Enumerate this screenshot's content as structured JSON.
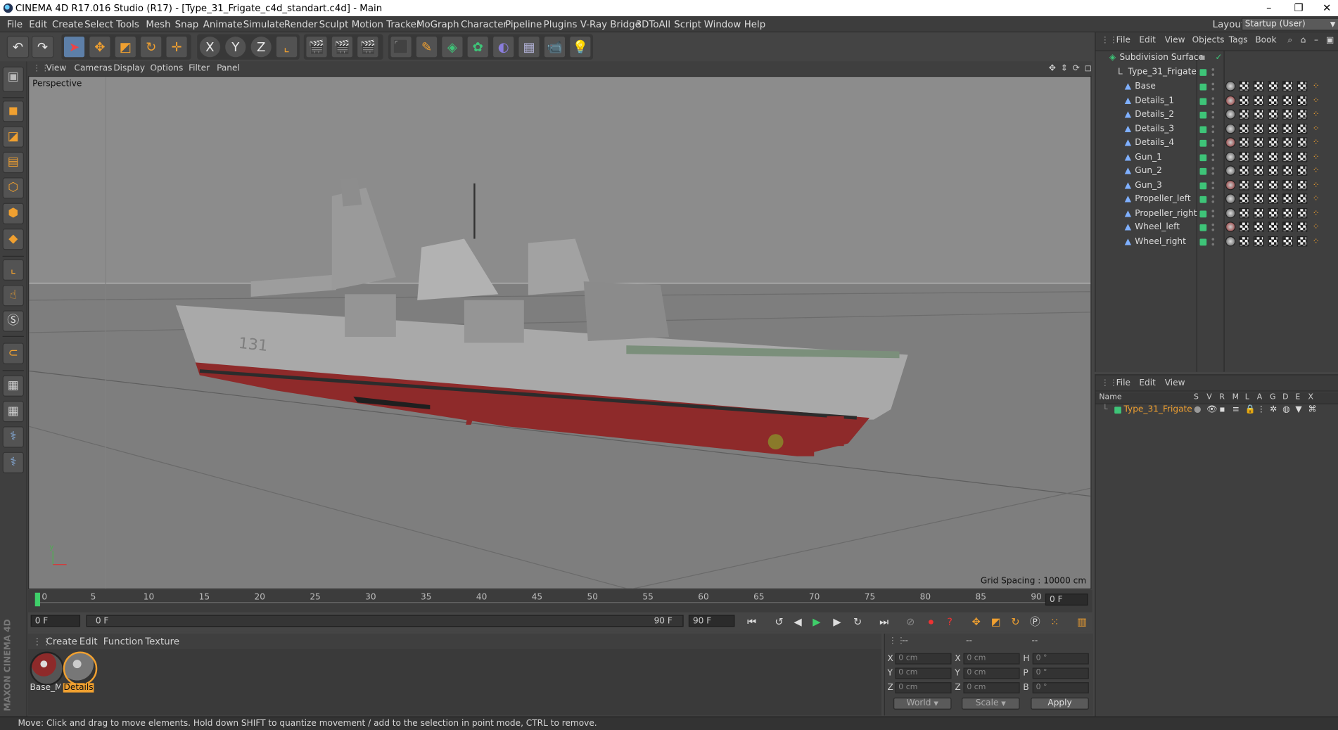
{
  "window": {
    "title": "CINEMA 4D R17.016 Studio (R17) - [Type_31_Frigate_c4d_standart.c4d] - Main",
    "min": "–",
    "max": "❐",
    "close": "✕"
  },
  "menu": [
    "File",
    "Edit",
    "Create",
    "Select",
    "Tools",
    "Mesh",
    "Snap",
    "Animate",
    "Simulate",
    "Render",
    "Sculpt",
    "Motion Tracker",
    "MoGraph",
    "Character",
    "Pipeline",
    "Plugins",
    "V-Ray Bridge",
    "3DToAll",
    "Script",
    "Window",
    "Help"
  ],
  "layout": {
    "label": "Layout:",
    "value": "Startup (User)"
  },
  "toolbar": {
    "axis_x": "X",
    "axis_y": "Y",
    "axis_z": "Z"
  },
  "viewport": {
    "menu": [
      "View",
      "Cameras",
      "Display",
      "Options",
      "Filter",
      "Panel"
    ],
    "mode": "Perspective",
    "grid_spacing": "Grid Spacing : 10000 cm",
    "hull_number": "131"
  },
  "timeline": {
    "ticks": [
      "0",
      "5",
      "10",
      "15",
      "20",
      "25",
      "30",
      "35",
      "40",
      "45",
      "50",
      "55",
      "60",
      "65",
      "70",
      "75",
      "80",
      "85",
      "90"
    ],
    "current_frame_right": "0 F",
    "start_field": "0 F",
    "range_start": "0 F",
    "range_end": "90 F",
    "end_field": "90 F"
  },
  "materials": {
    "menu": [
      "Create",
      "Edit",
      "Function",
      "Texture"
    ],
    "items": [
      {
        "label": "Base_M"
      },
      {
        "label": "Details"
      }
    ]
  },
  "coords": {
    "headers": [
      "--",
      "--",
      "--"
    ],
    "rows": [
      {
        "a": "X",
        "av": "0 cm",
        "b": "X",
        "bv": "0 cm",
        "c": "H",
        "cv": "0 °"
      },
      {
        "a": "Y",
        "av": "0 cm",
        "b": "Y",
        "bv": "0 cm",
        "c": "P",
        "cv": "0 °"
      },
      {
        "a": "Z",
        "av": "0 cm",
        "b": "Z",
        "bv": "0 cm",
        "c": "B",
        "cv": "0 °"
      }
    ],
    "space": "World",
    "mode": "Scale",
    "apply": "Apply"
  },
  "object_manager": {
    "menu": [
      "File",
      "Edit",
      "View",
      "Objects",
      "Tags",
      "Book"
    ],
    "root": "Subdivision Surface",
    "group": "Type_31_Frigate",
    "children": [
      "Base",
      "Details_1",
      "Details_2",
      "Details_3",
      "Details_4",
      "Gun_1",
      "Gun_2",
      "Gun_3",
      "Propeller_left",
      "Propeller_right",
      "Wheel_left",
      "Wheel_right"
    ]
  },
  "layer_manager": {
    "menu": [
      "File",
      "Edit",
      "View"
    ],
    "columns": [
      "Name",
      "S",
      "V",
      "R",
      "M",
      "L",
      "A",
      "G",
      "D",
      "E",
      "X"
    ],
    "layer": "Type_31_Frigate"
  },
  "status": "Move: Click and drag to move elements. Hold down SHIFT to quantize movement / add to the selection in point mode, CTRL to remove.",
  "brand": "MAXON CINEMA 4D",
  "colors": {
    "accent": "#3ec478",
    "layer": "#f0a030",
    "hull_red": "#8e2a2a"
  }
}
